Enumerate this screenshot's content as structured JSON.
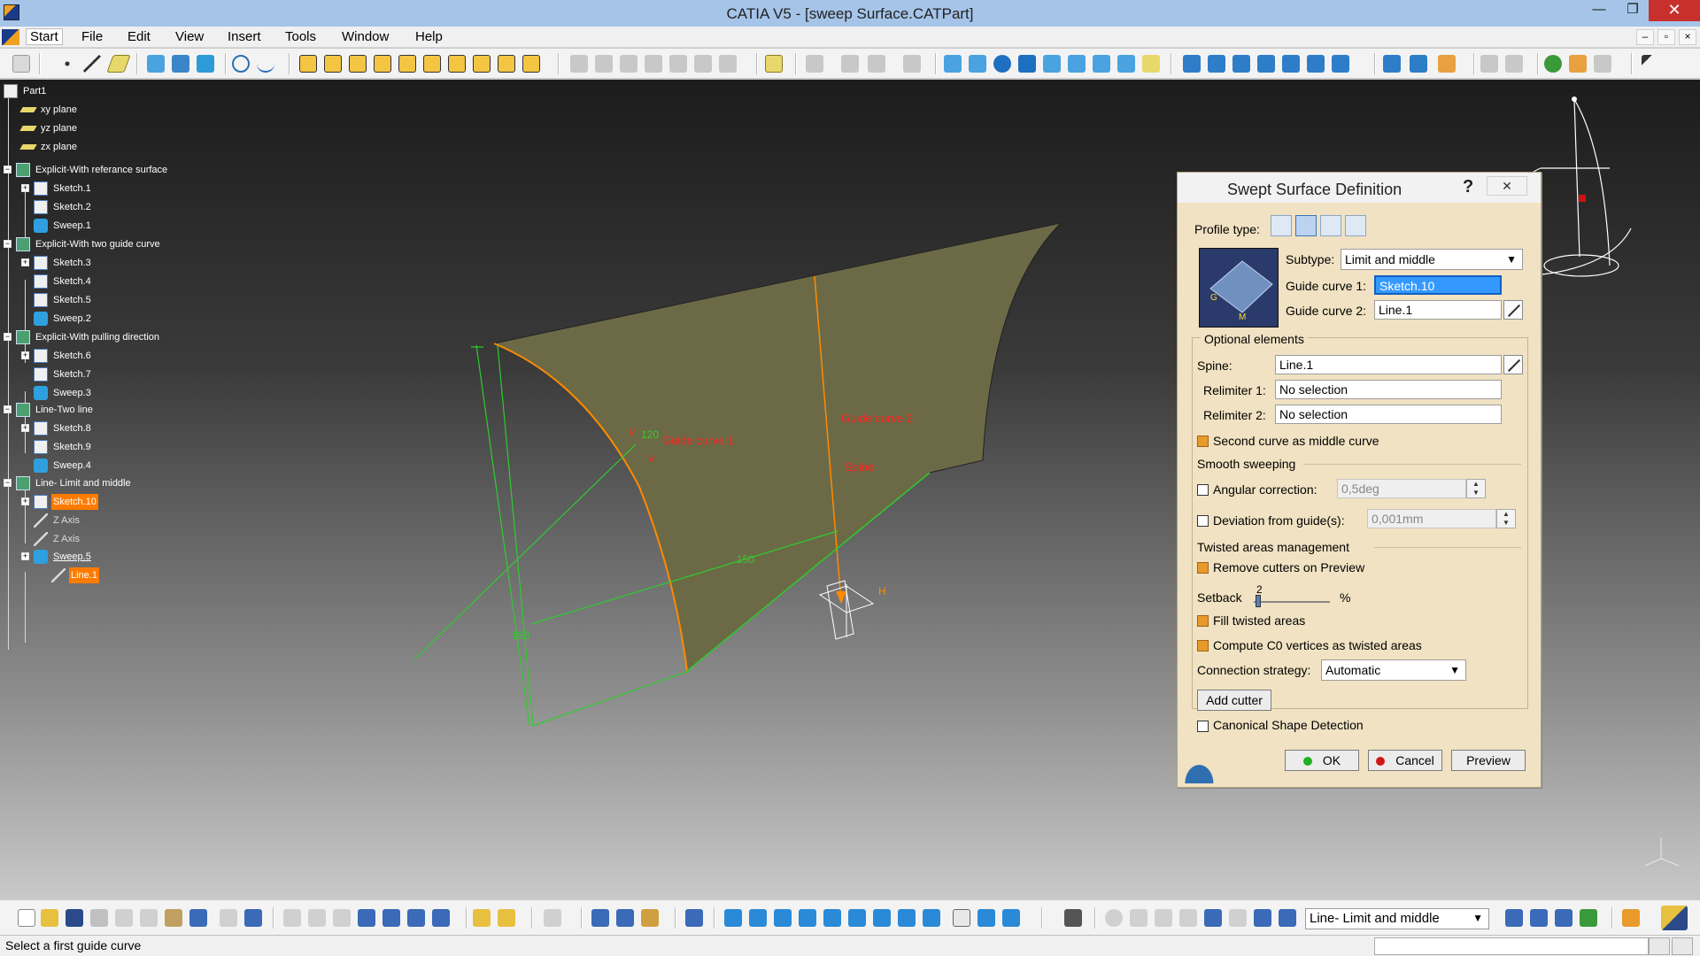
{
  "window": {
    "title": "CATIA V5 - [sweep Surface.CATPart]",
    "minimize": "—",
    "maximize": "❐",
    "close": "✕"
  },
  "menu": {
    "items": [
      "Start",
      "File",
      "Edit",
      "View",
      "Insert",
      "Tools",
      "Window",
      "Help"
    ],
    "mdi_minimize": "–",
    "mdi_restore": "▫",
    "mdi_close": "×"
  },
  "tree": {
    "root": "Part1",
    "nodes": [
      {
        "label": "xy plane",
        "icon": "plane-icon"
      },
      {
        "label": "yz plane",
        "icon": "plane-icon"
      },
      {
        "label": "zx plane",
        "icon": "plane-icon"
      },
      {
        "label": "Explicit-With referance surface",
        "icon": "geometrical-set-icon"
      },
      {
        "label": "Sketch.1",
        "icon": "sketch-icon"
      },
      {
        "label": "Sketch.2",
        "icon": "sketch-icon"
      },
      {
        "label": "Sweep.1",
        "icon": "sweep-icon"
      },
      {
        "label": "Explicit-With two guide curve",
        "icon": "geometrical-set-icon"
      },
      {
        "label": "Sketch.3",
        "icon": "sketch-icon"
      },
      {
        "label": "Sketch.4",
        "icon": "sketch-icon"
      },
      {
        "label": "Sketch.5",
        "icon": "sketch-icon"
      },
      {
        "label": "Sweep.2",
        "icon": "sweep-icon"
      },
      {
        "label": "Explicit-With pulling direction",
        "icon": "geometrical-set-icon"
      },
      {
        "label": "Sketch.6",
        "icon": "sketch-icon"
      },
      {
        "label": "Sketch.7",
        "icon": "sketch-icon"
      },
      {
        "label": "Sweep.3",
        "icon": "sweep-icon"
      },
      {
        "label": "Line-Two line",
        "icon": "geometrical-set-icon"
      },
      {
        "label": "Sketch.8",
        "icon": "sketch-icon"
      },
      {
        "label": "Sketch.9",
        "icon": "sketch-icon"
      },
      {
        "label": "Sweep.4",
        "icon": "sweep-icon"
      },
      {
        "label": "Line- Limit and middle",
        "icon": "geometrical-set-icon"
      },
      {
        "label": "Sketch.10",
        "icon": "sketch-icon"
      },
      {
        "label": "Z Axis",
        "icon": "line-icon"
      },
      {
        "label": "Z Axis",
        "icon": "line-icon"
      },
      {
        "label": "Sweep.5",
        "icon": "sweep-icon"
      },
      {
        "label": "Line.1",
        "icon": "line-icon"
      }
    ]
  },
  "viewport": {
    "annotations": {
      "guide_curve_1": "Guide curve 1",
      "guide_curve_2": "Guide curve 2",
      "spine": "Spine",
      "dim_120": "120",
      "dim_150_a": "150",
      "dim_150_b": "150",
      "dim_h": "H",
      "dim_v": "V",
      "dim_v2": "V"
    },
    "colors": {
      "surface": "#6c6a46",
      "guide": "#ff8a00",
      "dimension": "#22cc22",
      "annotation": "#ff2020"
    }
  },
  "dialog": {
    "title": "Swept Surface Definition",
    "help": "?",
    "close": "✕",
    "profile_type_label": "Profile type:",
    "subtype_label": "Subtype:",
    "subtype_value": "Limit and middle",
    "guide_curve_1_label": "Guide curve 1:",
    "guide_curve_1_value": "Sketch.10",
    "guide_curve_2_label": "Guide curve 2:",
    "guide_curve_2_value": "Line.1",
    "preview_g": "G",
    "preview_m": "M",
    "optional_elements": "Optional elements",
    "spine_label": "Spine:",
    "spine_value": "Line.1",
    "relimiter1_label": "Relimiter 1:",
    "relimiter1_value": "No selection",
    "relimiter2_label": "Relimiter 2:",
    "relimiter2_value": "No selection",
    "second_curve_middle": "Second curve as middle curve",
    "smooth_sweeping": "Smooth sweeping",
    "angular_correction": "Angular correction:",
    "angular_value": "0,5deg",
    "deviation_label": "Deviation from guide(s):",
    "deviation_value": "0,001mm",
    "twisted_areas": "Twisted areas management",
    "remove_cutters": "Remove cutters on Preview",
    "setback_label": "Setback",
    "setback_value": "2",
    "setback_unit": "%",
    "fill_twisted": "Fill twisted areas",
    "compute_c0": "Compute C0 vertices as twisted areas",
    "connection_label": "Connection strategy:",
    "connection_value": "Automatic",
    "add_cutter": "Add cutter",
    "canonical": "Canonical Shape Detection",
    "ok": "OK",
    "cancel": "Cancel",
    "preview": "Preview",
    "checks": {
      "second_curve_middle": true,
      "angular_correction": false,
      "deviation": false,
      "remove_cutters": true,
      "fill_twisted": true,
      "compute_c0": true,
      "canonical": false
    }
  },
  "bottom_toolbar": {
    "current_body": "Line- Limit and middle"
  },
  "status": {
    "message": "Select a first guide curve"
  }
}
